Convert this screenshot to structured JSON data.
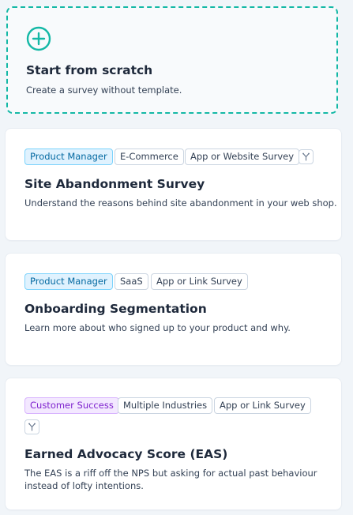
{
  "scratch": {
    "title": "Start from scratch",
    "description": "Create a survey without template.",
    "icon": "plus-circle-icon",
    "accent_color": "#14b8a6"
  },
  "templates": [
    {
      "tags": [
        "Product Manager",
        "E-Commerce",
        "App or Website Survey"
      ],
      "branching": true,
      "title": "Site Abandonment Survey",
      "description": "Understand the reasons behind site abandonment in your web shop."
    },
    {
      "tags": [
        "Product Manager",
        "SaaS",
        "App or Link Survey"
      ],
      "branching": false,
      "title": "Onboarding Segmentation",
      "description": "Learn more about who signed up to your product and why."
    },
    {
      "tags": [
        "Customer Success",
        "Multiple Industries",
        "App or Link Survey"
      ],
      "branching": true,
      "title": "Earned Advocacy Score (EAS)",
      "description": "The EAS is a riff off the NPS but asking for actual past behaviour instead of lofty intentions."
    }
  ],
  "colors": {
    "product_manager_tag": "#0369a1",
    "customer_success_tag": "#7e22ce"
  }
}
